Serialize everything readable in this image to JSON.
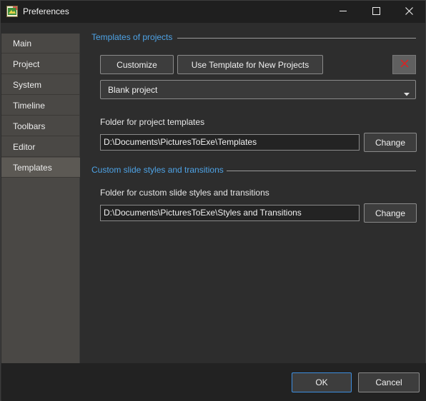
{
  "window": {
    "title": "Preferences",
    "minimize_icon": "minimize-icon",
    "maximize_icon": "maximize-icon",
    "close_icon": "close-icon"
  },
  "sidebar": {
    "items": [
      {
        "label": "Main"
      },
      {
        "label": "Project"
      },
      {
        "label": "System"
      },
      {
        "label": "Timeline"
      },
      {
        "label": "Toolbars"
      },
      {
        "label": "Editor"
      },
      {
        "label": "Templates",
        "active": true
      }
    ]
  },
  "templates_section": {
    "title": "Templates of projects",
    "customize_label": "Customize",
    "use_template_label": "Use Template for New Projects",
    "delete_icon": "delete-icon",
    "template_selected": "Blank project",
    "folder_label": "Folder for project templates",
    "folder_value": "D:\\Documents\\PicturesToExe\\Templates",
    "change_label": "Change"
  },
  "styles_section": {
    "title": "Custom slide styles and transitions",
    "folder_label": "Folder for custom slide styles and transitions",
    "folder_value": "D:\\Documents\\PicturesToExe\\Styles and Transitions",
    "change_label": "Change"
  },
  "footer": {
    "ok_label": "OK",
    "cancel_label": "Cancel"
  },
  "colors": {
    "accent": "#4ea3e6",
    "background": "#2d2d2d",
    "sidebar": "#4a4845",
    "delete": "#e02020"
  }
}
